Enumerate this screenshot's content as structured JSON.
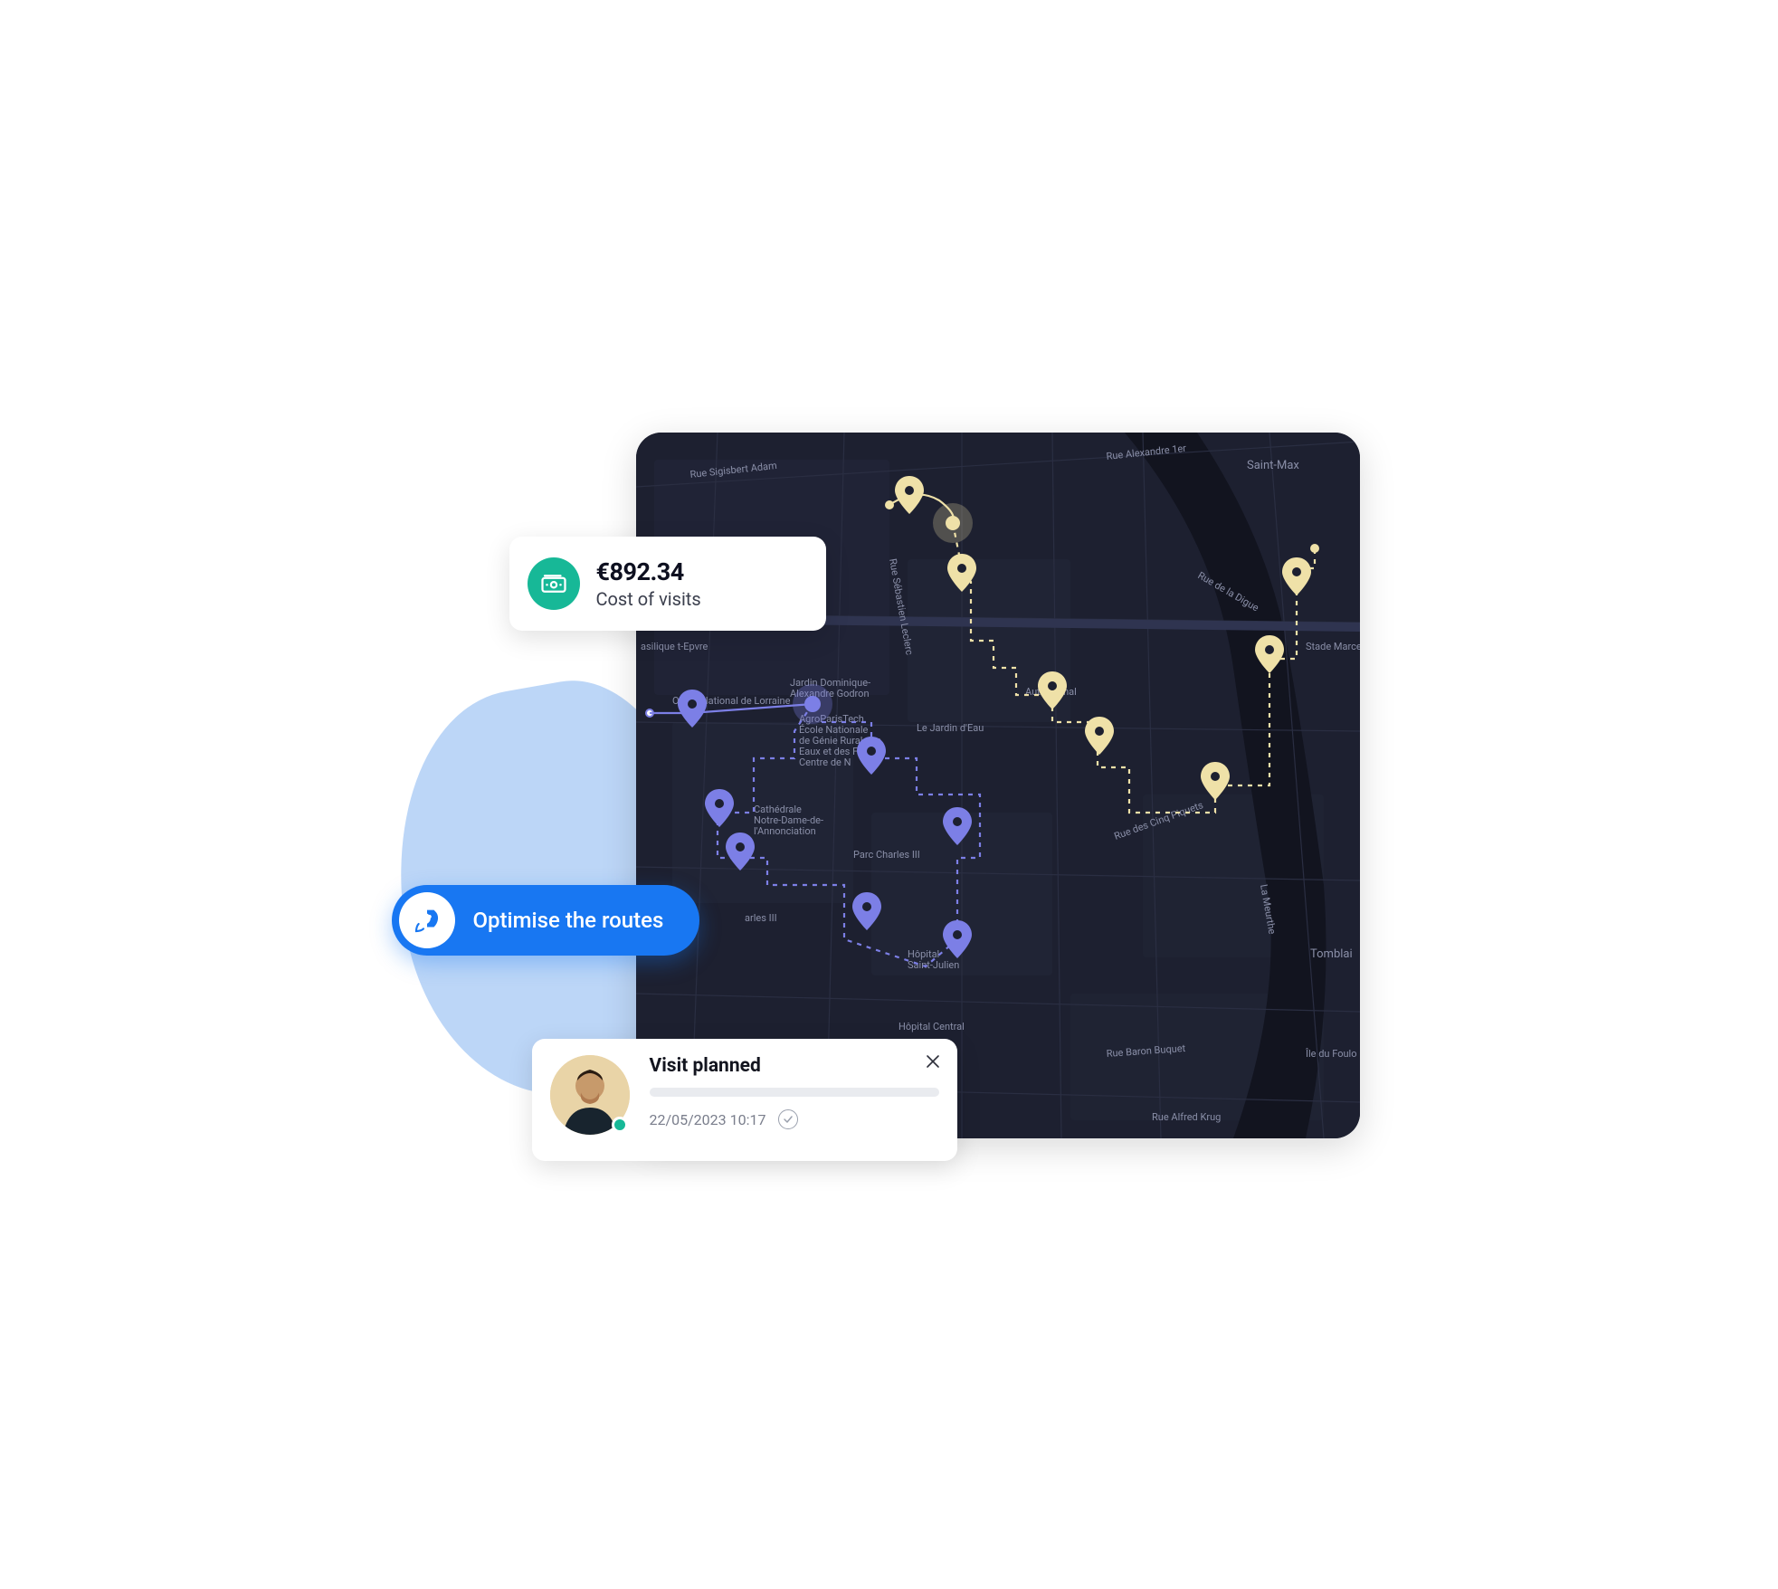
{
  "cost_card": {
    "amount": "€892.34",
    "label": "Cost of visits",
    "icon": "money-icon"
  },
  "optimise_button": {
    "label": "Optimise the routes",
    "icon": "rocket-icon"
  },
  "visit_card": {
    "title": "Visit planned",
    "datetime": "22/05/2023 10:17",
    "status_icon": "check-circle-icon",
    "close_icon": "close-icon",
    "avatar_presence": "online"
  },
  "map": {
    "neighborhood_labels": [
      "Saint-Max",
      "Tomblai"
    ],
    "street_labels": [
      "Rue Sigisbert Adam",
      "Rue Alexandre 1er",
      "Rue Sébastien Leclerc",
      "Rue de la Digue",
      "Autre Canal",
      "Le Jardin d'Eau",
      "Rue des Cinq Piquets",
      "Rue Baron Buquet",
      "Rue Alfred Krug",
      "Île du Foulo",
      "La Meurthe"
    ],
    "poi_labels": [
      "asilique t-Epvre",
      "Opéra National de Lorraine",
      "Jardin Dominique-Alexandre Godron",
      "AgroParisTech École Nationale de Génie Rural des Eaux et des Forêts Centre de N",
      "Cathédrale Notre-Dame-de-l'Annonciation",
      "Parc Charles III",
      "arles III",
      "Hôpital Saint-Julien",
      "Hôpital Central",
      "Stade Marce"
    ],
    "routes": [
      {
        "color": "#efe1a8",
        "name": "route-yellow",
        "markers": 7
      },
      {
        "color": "#7c7fe6",
        "name": "route-blue",
        "markers": 7
      }
    ]
  },
  "colors": {
    "accent_blue": "#1877f2",
    "accent_teal": "#17b897",
    "route_yellow": "#efe1a8",
    "route_indigo": "#7c7fe6",
    "map_bg": "#1d2030",
    "blob": "#bcd6f7"
  }
}
